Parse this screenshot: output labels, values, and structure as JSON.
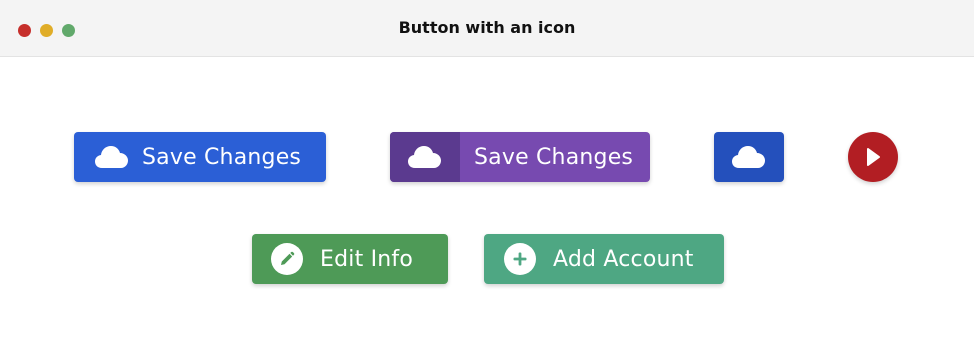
{
  "window": {
    "title": "Button with an icon",
    "controls": {
      "close_color": "#c62f2b",
      "minimize_color": "#e0ad28",
      "zoom_color": "#61a96b"
    }
  },
  "buttons": {
    "save_primary": {
      "label": "Save Changes",
      "icon": "cloud-icon",
      "color": "#2b5fd6"
    },
    "save_split": {
      "label": "Save Changes",
      "icon": "cloud-icon",
      "icon_bg": "#5b3a8f",
      "color": "#774ab0"
    },
    "cloud_only": {
      "icon": "cloud-icon",
      "color": "#2450bc"
    },
    "play_round": {
      "icon": "play-icon",
      "color": "#b21e23"
    },
    "edit_info": {
      "label": "Edit Info",
      "icon": "pencil-icon",
      "color": "#4e9a57"
    },
    "add_account": {
      "label": "Add Account",
      "icon": "plus-icon",
      "color": "#4ea783"
    }
  }
}
